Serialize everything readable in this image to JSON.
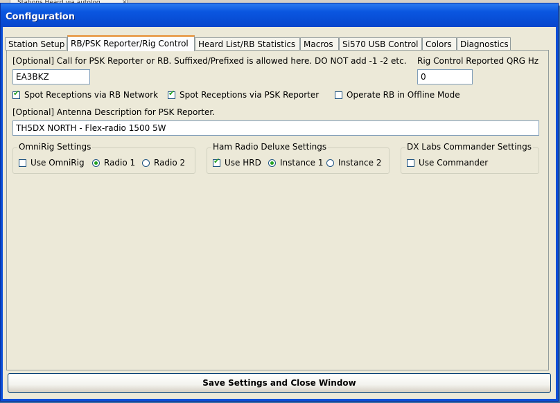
{
  "background": {
    "tab_label": "Stations Heard via autolog"
  },
  "window": {
    "title": "Configuration"
  },
  "tabs": [
    {
      "label": "Station Setup"
    },
    {
      "label": "RB/PSK Reporter/Rig Control"
    },
    {
      "label": "Heard List/RB Statistics"
    },
    {
      "label": "Macros"
    },
    {
      "label": "Si570 USB Control"
    },
    {
      "label": "Colors"
    },
    {
      "label": "Diagnostics"
    }
  ],
  "active_tab": "RB/PSK Reporter/Rig Control",
  "callsign": {
    "label": "[Optional] Call for PSK Reporter or RB.  Suffixed/Prefixed is allowed here.  DO NOT add -1 -2 etc.",
    "value": "EA3BKZ"
  },
  "qrg": {
    "label": "Rig Control Reported QRG Hz",
    "value": "0"
  },
  "options": {
    "spot_rb": {
      "label": "Spot Receptions via RB Network",
      "checked": true
    },
    "spot_psk": {
      "label": "Spot Receptions via PSK Reporter",
      "checked": true
    },
    "offline": {
      "label": "Operate RB in Offline Mode",
      "checked": false
    }
  },
  "antenna": {
    "label": "[Optional] Antenna Description for PSK Reporter.",
    "value": "TH5DX NORTH  - Flex-radio 1500 5W"
  },
  "omnirig": {
    "title": "OmniRig Settings",
    "use_label": "Use OmniRig",
    "use_checked": false,
    "radio1_label": "Radio 1",
    "radio2_label": "Radio 2",
    "selected": "Radio 1"
  },
  "hrd": {
    "title": "Ham Radio Deluxe Settings",
    "use_label": "Use HRD",
    "use_checked": true,
    "instance1_label": "Instance 1",
    "instance2_label": "Instance 2",
    "selected": "Instance 1"
  },
  "dxlabs": {
    "title": "DX Labs Commander Settings",
    "use_label": "Use Commander",
    "use_checked": false
  },
  "save_button": {
    "label": "Save Settings and Close Window"
  },
  "colors": {
    "titlebar": "#0a56e0",
    "face": "#ece9d8",
    "check_mark": "#21a121",
    "active_tab_accent": "#e68b2c"
  }
}
